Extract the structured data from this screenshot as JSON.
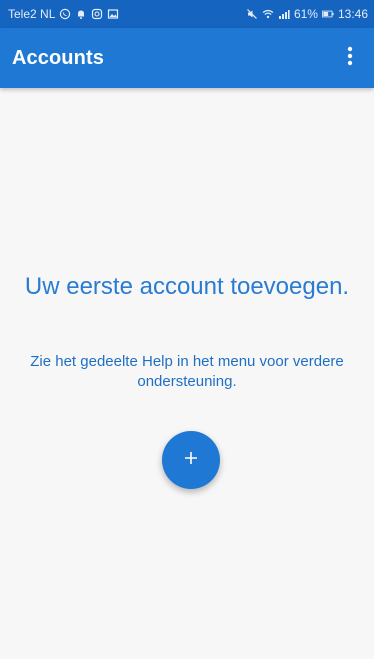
{
  "status_bar": {
    "carrier": "Tele2 NL",
    "left_icons": [
      "whatsapp-icon",
      "notification-icon",
      "instagram-icon",
      "gallery-icon"
    ],
    "right_icons": [
      "mute-icon",
      "wifi-icon",
      "signal-icon"
    ],
    "battery": "61%",
    "time": "13:46"
  },
  "app_bar": {
    "title": "Accounts",
    "menu_icon": "more-vert-icon"
  },
  "empty_state": {
    "title": "Uw eerste account toevoegen.",
    "subtitle": "Zie het gedeelte Help in het menu voor verdere ondersteuning."
  },
  "fab": {
    "icon": "plus-icon"
  },
  "colors": {
    "status_bar": "#1565c0",
    "app_bar": "#1e78d4",
    "accent_text": "#2a7bd2",
    "background": "#f7f7f7"
  }
}
